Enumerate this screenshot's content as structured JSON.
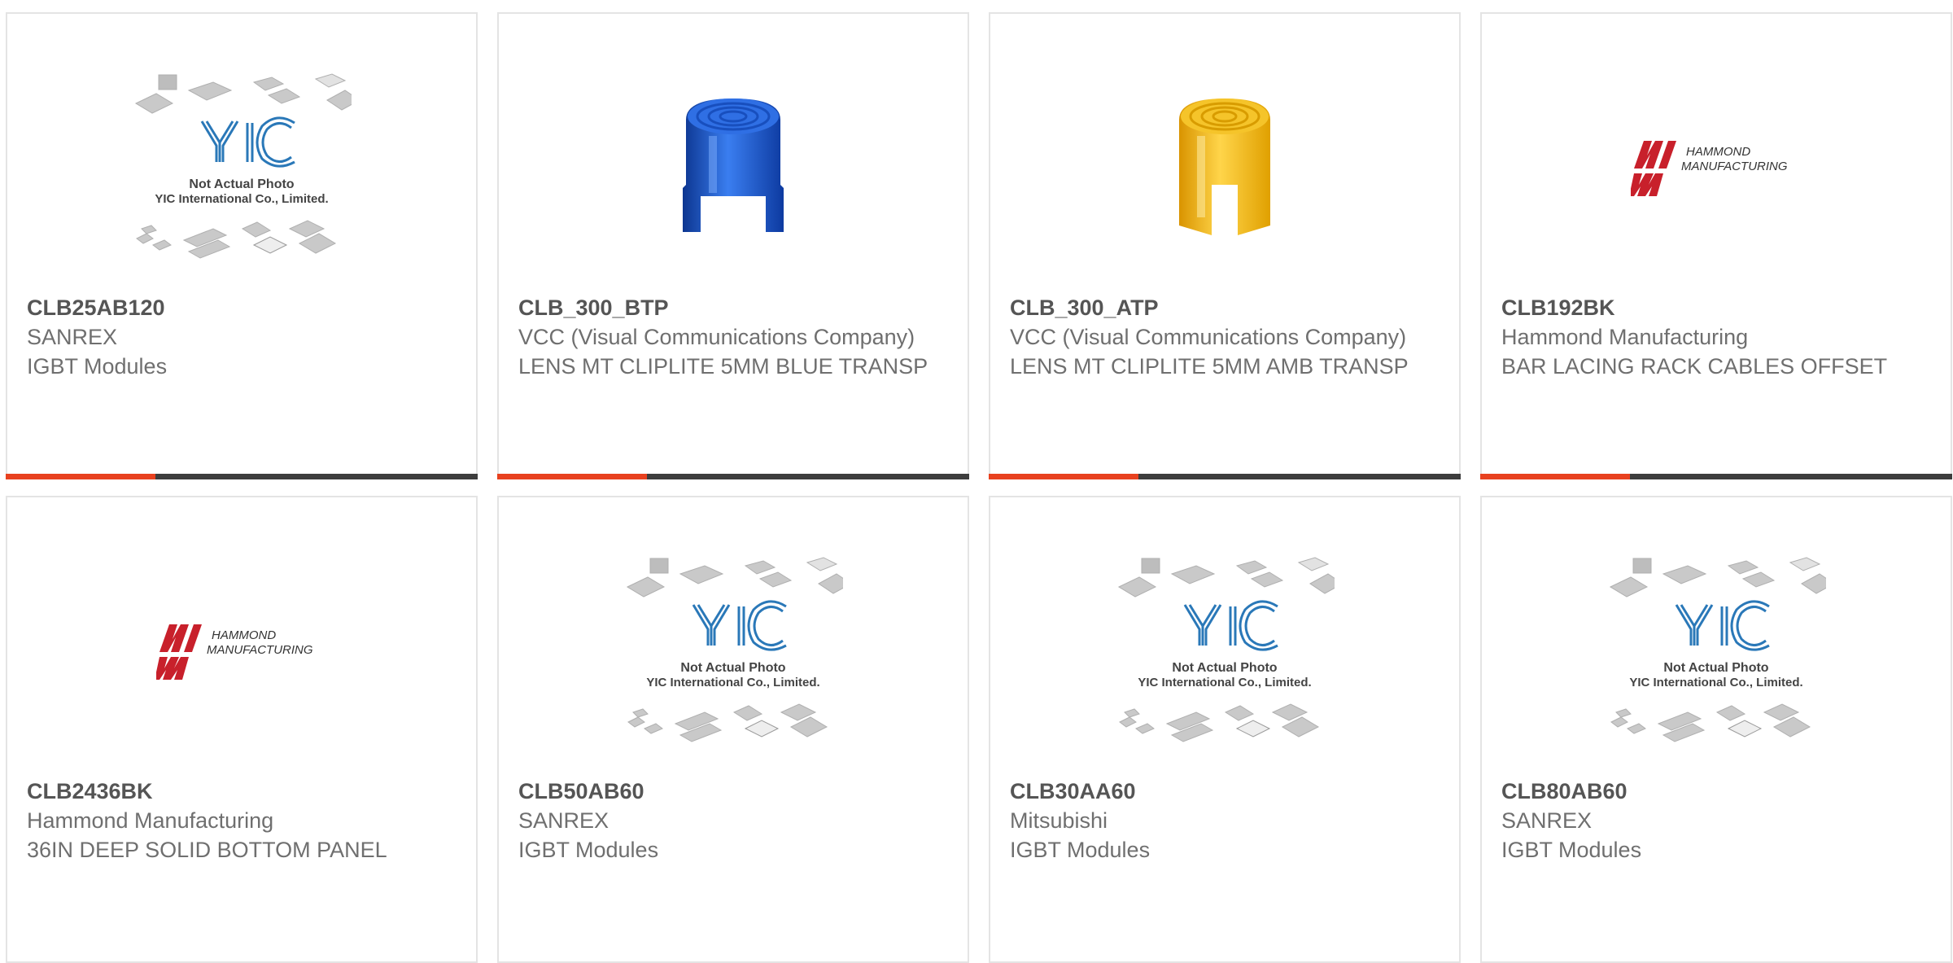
{
  "products": [
    {
      "part_number": "CLB25AB120",
      "manufacturer": "SANREX",
      "description": "IGBT Modules",
      "image": "yic-placeholder",
      "image_caption_line1": "Not Actual Photo",
      "image_caption_line2": "YIC International Co., Limited."
    },
    {
      "part_number": "CLB_300_BTP",
      "manufacturer": "VCC (Visual Communications Company)",
      "description": "LENS MT CLIPLITE 5MM BLUE TRANSP",
      "image": "lens-blue"
    },
    {
      "part_number": "CLB_300_ATP",
      "manufacturer": "VCC (Visual Communications Company)",
      "description": "LENS MT CLIPLITE 5MM AMB TRANSP",
      "image": "lens-amber"
    },
    {
      "part_number": "CLB192BK",
      "manufacturer": "Hammond Manufacturing",
      "description": "BAR LACING RACK CABLES OFFSET",
      "image": "hammond-logo",
      "logo_line1": "HAMMOND",
      "logo_line2": "MANUFACTURING"
    },
    {
      "part_number": "CLB2436BK",
      "manufacturer": "Hammond Manufacturing",
      "description": "36IN DEEP SOLID BOTTOM PANEL",
      "image": "hammond-logo",
      "logo_line1": "HAMMOND",
      "logo_line2": "MANUFACTURING"
    },
    {
      "part_number": "CLB50AB60",
      "manufacturer": "SANREX",
      "description": "IGBT Modules",
      "image": "yic-placeholder",
      "image_caption_line1": "Not Actual Photo",
      "image_caption_line2": "YIC International Co., Limited."
    },
    {
      "part_number": "CLB30AA60",
      "manufacturer": "Mitsubishi",
      "description": "IGBT Modules",
      "image": "yic-placeholder",
      "image_caption_line1": "Not Actual Photo",
      "image_caption_line2": "YIC International Co., Limited."
    },
    {
      "part_number": "CLB80AB60",
      "manufacturer": "SANREX",
      "description": "IGBT Modules",
      "image": "yic-placeholder",
      "image_caption_line1": "Not Actual Photo",
      "image_caption_line2": "YIC International Co., Limited."
    }
  ],
  "colors": {
    "accent": "#e8411f",
    "bar_dark": "#3d3d3d",
    "card_border": "#e4e4e4",
    "part_number_text": "#555555",
    "body_text": "#6f6f6f",
    "hammond_red": "#c8202b",
    "yic_blue": "#2a78b8",
    "lens_blue": "#1d55c9",
    "lens_amber": "#f2b614"
  }
}
